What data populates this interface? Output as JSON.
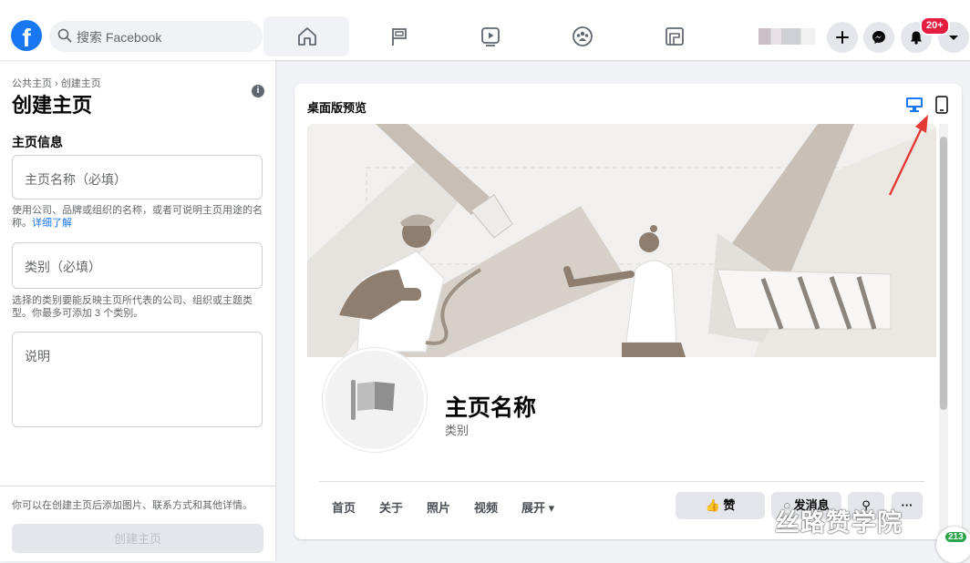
{
  "topbar": {
    "logo": "facebook-logo",
    "search_placeholder": "搜索 Facebook",
    "nav_tabs": [
      "home-icon",
      "pages-flag-icon",
      "watch-video-icon",
      "groups-icon",
      "gaming-icon"
    ],
    "active_tab": "home-icon",
    "notification_count": "20+",
    "actions": [
      "plus-icon",
      "messenger-icon",
      "bell-icon",
      "caret-down-icon"
    ]
  },
  "sidebar": {
    "breadcrumb": "公共主页 › 创建主页",
    "title": "创建主页",
    "section_title": "主页信息",
    "name_field": {
      "placeholder": "主页名称（必填）",
      "value": ""
    },
    "name_help": "使用公司、品牌或组织的名称，或者可说明主页用途的名称。",
    "name_help_link": "详细了解",
    "category_field": {
      "placeholder": "类别（必填）",
      "value": ""
    },
    "category_help": "选择的类别要能反映主页所代表的公司、组织或主题类型。你最多可添加 3 个类别。",
    "description_field": {
      "placeholder": "说明",
      "value": ""
    },
    "footer_note": "你可以在创建主页后添加图片、联系方式和其他详情。",
    "create_button": "创建主页"
  },
  "preview": {
    "title": "桌面版预览",
    "view_modes": [
      "desktop-icon",
      "mobile-icon"
    ],
    "active_view": "desktop-icon",
    "page_name": "主页名称",
    "page_category": "类别",
    "tabs": [
      "首页",
      "关于",
      "照片",
      "视频",
      "展开"
    ],
    "like_button": "赞",
    "message_button": "发消息"
  },
  "watermark": {
    "text": "丝路赞学院",
    "badge": "213"
  },
  "colors": {
    "brand": "#1877f2",
    "badge_red": "#e41e3f",
    "annotation_arrow": "#e53935"
  }
}
